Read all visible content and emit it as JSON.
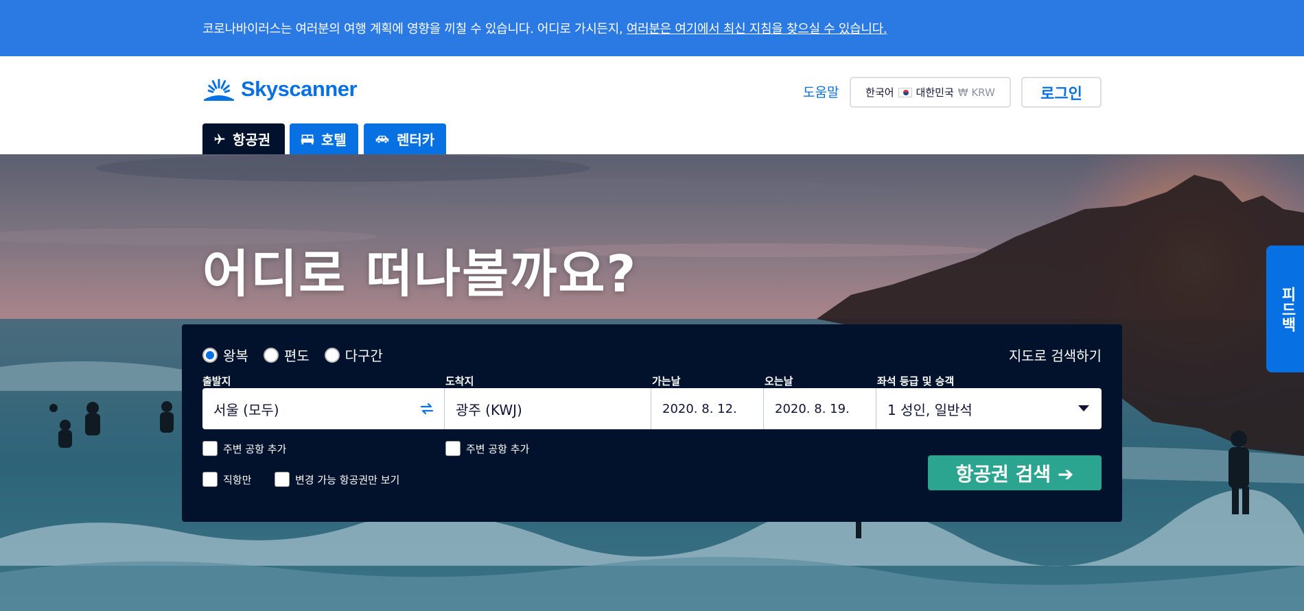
{
  "banner": {
    "text": "코로나바이러스는 여러분의 여행 계획에 영향을 끼칠 수 있습니다. 어디로 가시든지, ",
    "link": "여러분은 여기에서 최신 지침을 찾으실 수 있습니다."
  },
  "header": {
    "logo": "Skyscanner",
    "help": "도움말",
    "locale": {
      "language": "한국어",
      "country": "대한민국",
      "currency": "₩ KRW"
    },
    "login": "로그인"
  },
  "tabs": [
    {
      "label": "항공권",
      "icon": "plane-icon"
    },
    {
      "label": "호텔",
      "icon": "bed-icon"
    },
    {
      "label": "렌터카",
      "icon": "car-icon"
    }
  ],
  "hero": {
    "title": "어디로 떠나볼까요?"
  },
  "search": {
    "trip_types": [
      "왕복",
      "편도",
      "다구간"
    ],
    "selected_trip_type": "왕복",
    "map_link": "지도로 검색하기",
    "labels": {
      "origin": "출발지",
      "destination": "도착지",
      "depart": "가는날",
      "return": "오는날",
      "cabin": "좌석 등급 및 승객"
    },
    "values": {
      "origin": "서울 (모두)",
      "destination": "광주 (KWJ)",
      "depart": "2020. 8. 12.",
      "return": "2020. 8. 19.",
      "cabin": "1 성인, 일반석"
    },
    "checkboxes": {
      "origin_nearby": "주변 공항 추가",
      "dest_nearby": "주변 공항 추가",
      "direct": "직항만",
      "flexible": "변경 가능 항공권만 보기"
    },
    "button": "항공권 검색 ➔"
  },
  "feedback": {
    "label": "피드백"
  },
  "colors": {
    "banner": "#2b7ae4",
    "brand": "#0770e3",
    "panel": "#02122c",
    "search_button": "#2ba58f"
  }
}
